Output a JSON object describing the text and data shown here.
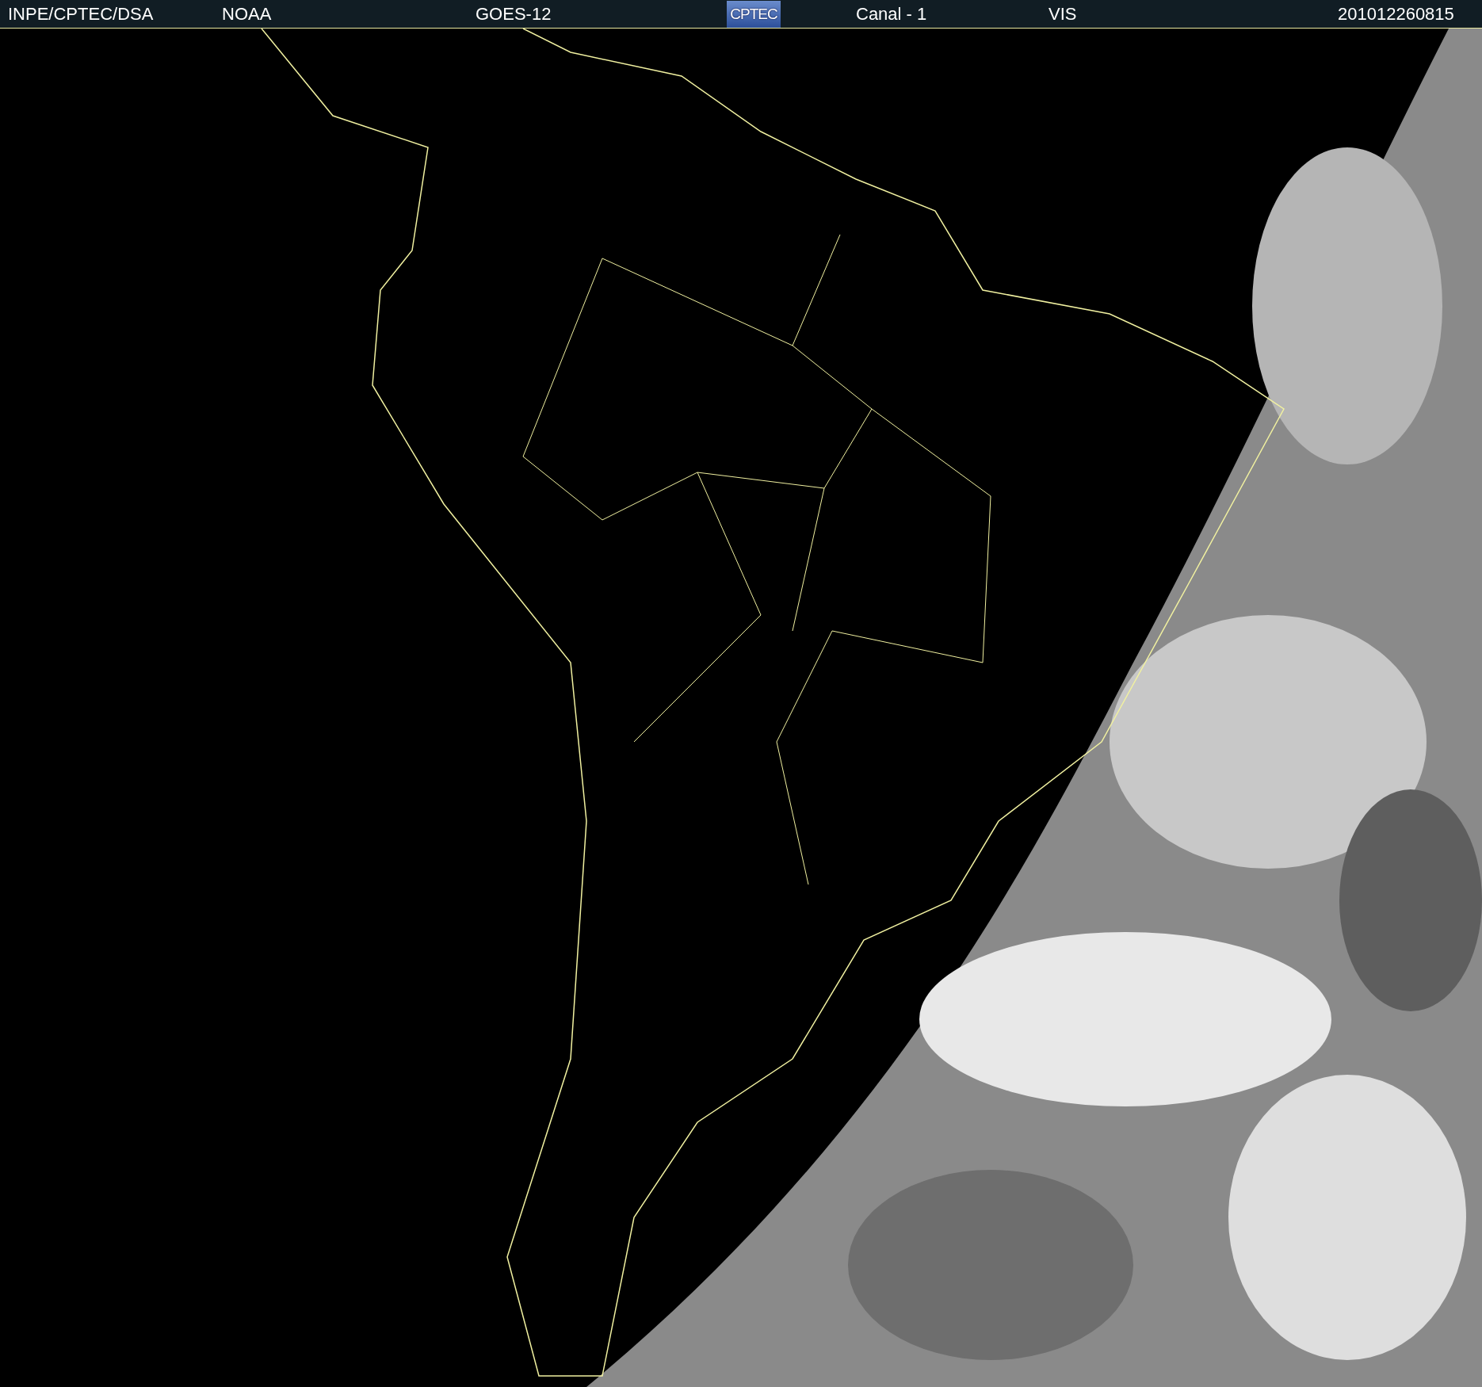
{
  "header": {
    "source": "INPE/CPTEC/DSA",
    "agency": "NOAA",
    "satellite": "GOES-12",
    "logo": "CPTEC",
    "channel": "Canal - 1",
    "band": "VIS",
    "timestamp": "201012260815"
  }
}
